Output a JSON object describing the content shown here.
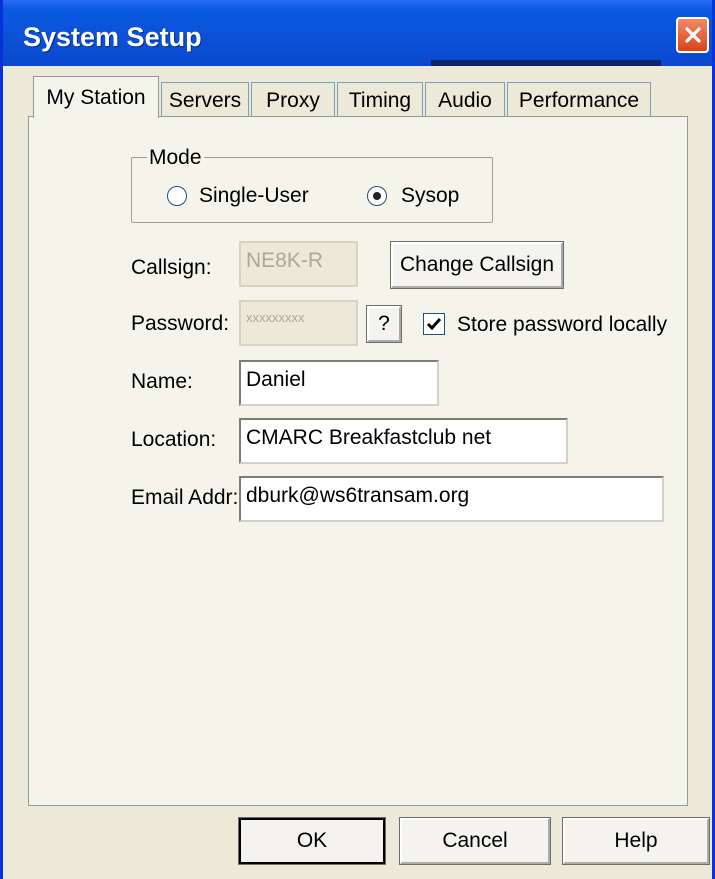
{
  "window": {
    "title": "System Setup"
  },
  "tabs": [
    {
      "label": "My Station",
      "active": true
    },
    {
      "label": "Servers"
    },
    {
      "label": "Proxy"
    },
    {
      "label": "Timing"
    },
    {
      "label": "Audio"
    },
    {
      "label": "Performance"
    }
  ],
  "mode": {
    "title": "Mode",
    "single_user_label": "Single-User",
    "sysop_label": "Sysop",
    "selected": "Sysop"
  },
  "callsign": {
    "label": "Callsign:",
    "value": "NE8K-R",
    "change_button": "Change Callsign"
  },
  "password": {
    "label": "Password:",
    "value": "xxxxxxxxx",
    "help_button": "?",
    "store_label": "Store password locally",
    "store_checked": true
  },
  "name": {
    "label": "Name:",
    "value": "Daniel"
  },
  "location": {
    "label": "Location:",
    "value": "CMARC Breakfastclub net"
  },
  "email": {
    "label": "Email Addr:",
    "value": "dburk@ws6transam.org"
  },
  "buttons": {
    "ok": "OK",
    "cancel": "Cancel",
    "help": "Help"
  },
  "colors": {
    "titlebar": "#0b4fd6",
    "face": "#ece9d8",
    "close": "#d9431a"
  }
}
